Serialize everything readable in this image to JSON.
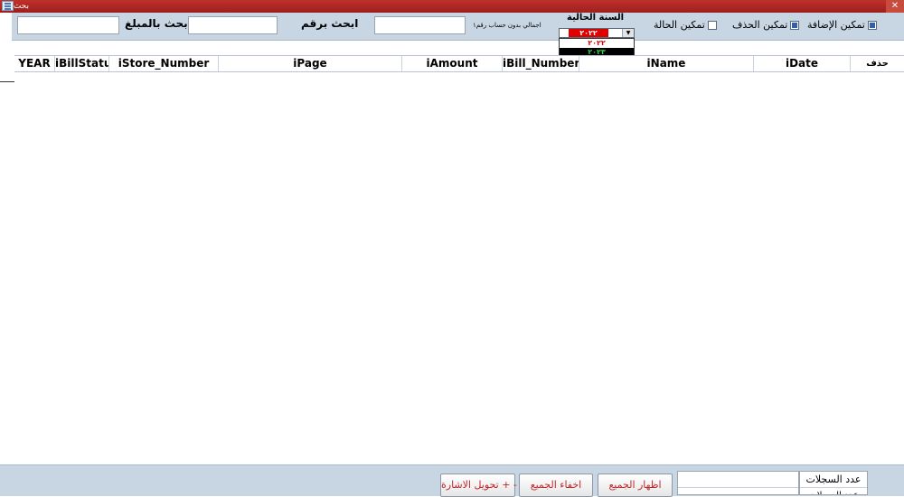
{
  "window": {
    "title": "بحث",
    "close_symbol": "✕"
  },
  "header": {
    "search_amount_label": "ابحث بالمبلغ",
    "search_number_label": "ابحث برقم",
    "total_no_account_label": "اجمالي بدون حساب رقم١",
    "current_year_label": "السنة الحالية",
    "current_year_value": "٢٠٢٢",
    "year_options": [
      "٢٠٢٢",
      "٢٠٢٣"
    ],
    "enable_status_label": "تمكين الحالة",
    "enable_delete_label": "تمكين الحذف",
    "enable_add_label": "تمكين الإضافة",
    "enable_status_checked": false,
    "enable_delete_checked": true,
    "enable_add_checked": true,
    "dropdown_arrow": "▼"
  },
  "table": {
    "columns": [
      "YEAR",
      "iBillStatus",
      "iStore_Number",
      "iPage",
      "iAmount",
      "iBill_Number",
      "iName",
      "iDate",
      "حذف"
    ]
  },
  "footer": {
    "toggle_sign_button": "تحويل الاشارة + -",
    "hide_all_button": "اخفاء الجميع",
    "show_all_button": "اظهار الجميع",
    "record_count_label": "عدد السجلات",
    "second_label": "عدد السجلات"
  },
  "colors": {
    "accent_red": "#c0262a",
    "panel_blue": "#c8d6e4",
    "title_red": "#b02622"
  }
}
